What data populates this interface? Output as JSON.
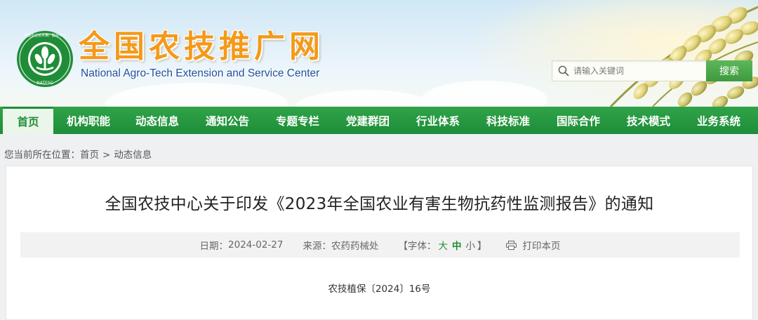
{
  "header": {
    "site_title": "全国农技推广网",
    "site_subtitle": "National Agro-Tech Extension and Service Center",
    "logo_ring_text": "全国农业技术推广服务中心",
    "logo_bottom_text": "NATESC"
  },
  "search": {
    "placeholder": "请输入关键词",
    "button_label": "搜索"
  },
  "nav": {
    "items": [
      {
        "label": "首页",
        "active": true
      },
      {
        "label": "机构职能"
      },
      {
        "label": "动态信息"
      },
      {
        "label": "通知公告"
      },
      {
        "label": "专题专栏"
      },
      {
        "label": "党建群团"
      },
      {
        "label": "行业体系"
      },
      {
        "label": "科技标准"
      },
      {
        "label": "国际合作"
      },
      {
        "label": "技术模式"
      },
      {
        "label": "业务系统"
      }
    ]
  },
  "breadcrumb": {
    "prefix": "您当前所在位置：",
    "home": "首页",
    "separator": ">",
    "current": "动态信息"
  },
  "article": {
    "title": "全国农技中心关于印发《2023年全国农业有害生物抗药性监测报告》的通知",
    "date_label": "日期：",
    "date": "2024-02-27",
    "source_label": "来源：",
    "source": "农药药械处",
    "font_open": "【字体：",
    "font_large": "大",
    "font_medium": "中",
    "font_small": "小",
    "font_close": "】",
    "print_label": "打印本页",
    "doc_number": "农技植保〔2024〕16号"
  },
  "colors": {
    "brand_green": "#1f8d38",
    "title_orange": "#f39a1a",
    "subtitle_blue": "#1e4f9a"
  }
}
